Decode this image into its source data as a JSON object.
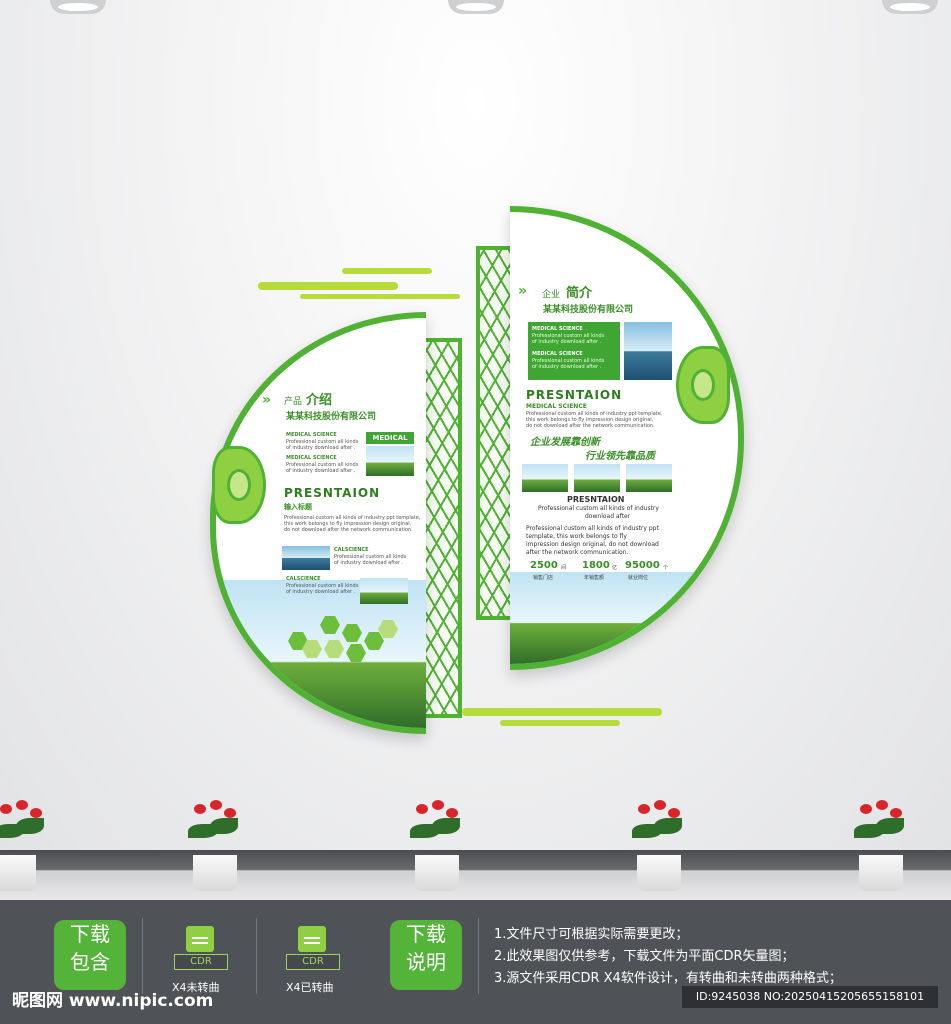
{
  "left_panel": {
    "title_small": "产品",
    "title_big": "介绍",
    "company": "某某科技股份有限公司",
    "med1_title": "MEDICAL SCIENCE",
    "med1_text": "Professional custom all kinds",
    "med1_text2": "of industry download after .",
    "med2_title": "MEDICAL SCIENCE",
    "med2_text": "Professional custom all kinds",
    "med2_text2": "of industry download after .",
    "badge": "MEDICAL",
    "heading": "PRESNTAION",
    "subheading": "输入标题",
    "para1": "Professional custom all kinds of industry ppt template,",
    "para2": "this work belongs to fly impression design original,",
    "para3": "do not download after the network communication.",
    "cal1_title": "CALSCIENCE",
    "cal1_text": "Professional custom all kinds",
    "cal1_text2": "of industry download after .",
    "cal2_title": "CALSCIENCE",
    "cal2_text": "Professional custom all kinds",
    "cal2_text2": "of industry download after ."
  },
  "right_panel": {
    "title_small": "企业",
    "title_big": "简介",
    "company": "某某科技股份有限公司",
    "med1_title": "MEDICAL SCIENCE",
    "med1_text": "Professional custom all kinds",
    "med1_text2": "of industry download after .",
    "med2_title": "MEDICAL SCIENCE",
    "med2_text": "Professional custom all kinds",
    "med2_text2": "of industry download after .",
    "heading": "PRESNTAION",
    "sub": "MEDICAL SCIENCE",
    "para1": "Professional custom all kinds of industry ppt template,",
    "para2": "this work belongs to fly impression design original,",
    "para3": "do not download after the network communication.",
    "slogan1": "企业发展靠创新",
    "slogan2": "行业领先靠品质",
    "heading2": "PRESNTAION",
    "line1": "Professional custom all kinds of industry",
    "line2": "download after",
    "para4": "Professional custom all kinds of industry ppt",
    "para5": "template, this work belongs to fly",
    "para6": "impression design original, do not download",
    "para7": "after the network communication.",
    "stat1_value": "2500",
    "stat1_unit": "间",
    "stat1_label": "销售门店",
    "stat2_value": "1800",
    "stat2_unit": "亿",
    "stat2_label": "年销售额",
    "stat3_value": "95000",
    "stat3_unit": "个",
    "stat3_label": "就业岗位"
  },
  "footer": {
    "btn1_line1": "下载",
    "btn1_line2": "包含",
    "cdr_label": "CDR",
    "cap1": "X4未转曲",
    "cap2": "X4已转曲",
    "btn2_line1": "下载",
    "btn2_line2": "说明",
    "info1": "1.文件尺寸可根据实际需要更改；",
    "info2": "2.此效果图仅供参考，下载文件为平面CDR矢量图；",
    "info3": "3.源文件采用CDR X4软件设计，有转曲和未转曲两种格式；",
    "brand": "昵图网 www.nipic.com",
    "id": "ID:9245038 NO:20250415205655158101"
  },
  "colors": {
    "accent": "#4fb233",
    "dark_green": "#3a8f27",
    "footer_bg": "#4f5256"
  }
}
